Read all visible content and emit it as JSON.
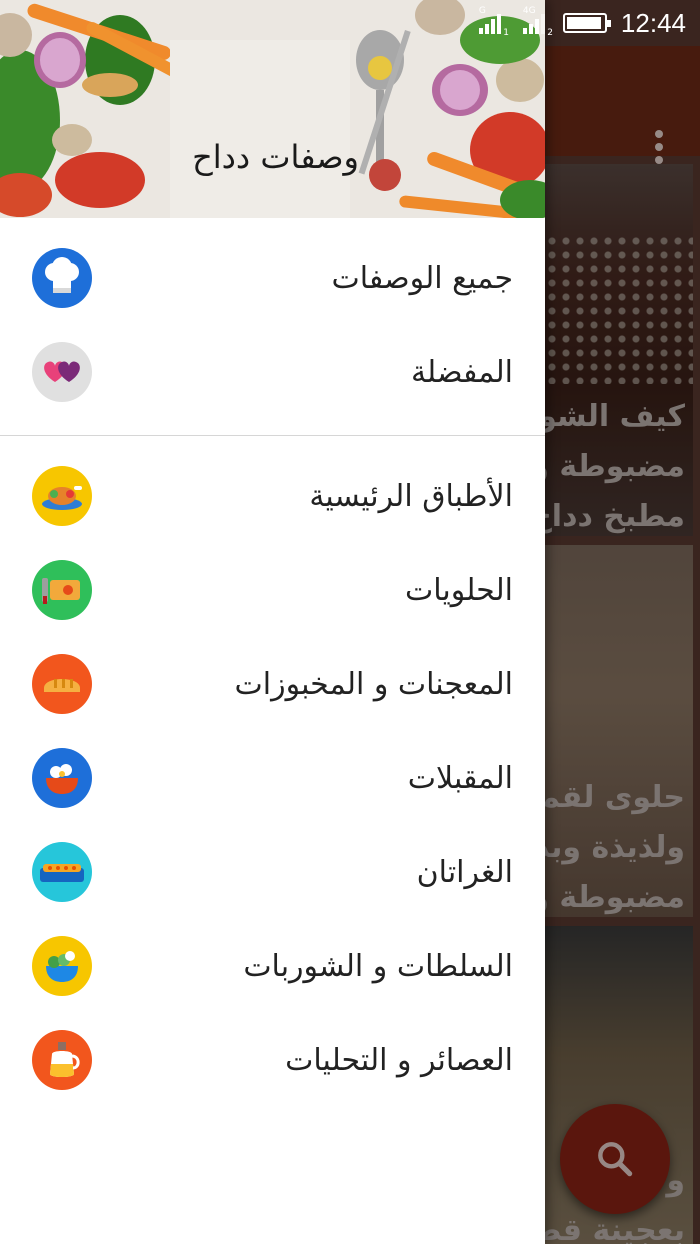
{
  "status_bar": {
    "sim1_label": "G",
    "sim1_sub": "1",
    "sim2_label": "4G",
    "sim2_sub": "2",
    "battery_level": 0.95,
    "time": "12:44"
  },
  "drawer": {
    "title": "وصفات دداح",
    "primary_items": [
      {
        "label": "جميع الوصفات",
        "icon": "chef-hat-icon",
        "color": "#1e6fd9"
      },
      {
        "label": "المفضلة",
        "icon": "hearts-icon",
        "color": "#e0e0e0"
      }
    ],
    "category_items": [
      {
        "label": "الأطباق الرئيسية",
        "icon": "roast-chicken-icon",
        "color": "#f7c600"
      },
      {
        "label": "الحلويات",
        "icon": "cake-board-icon",
        "color": "#2fbf5a"
      },
      {
        "label": "المعجنات و المخبوزات",
        "icon": "bread-icon",
        "color": "#f2561d"
      },
      {
        "label": "المقبلات",
        "icon": "appetizer-bowl-icon",
        "color": "#1e6fd9"
      },
      {
        "label": "الغراتان",
        "icon": "gratin-dish-icon",
        "color": "#26c6da"
      },
      {
        "label": "السلطات و الشوربات",
        "icon": "salad-bowl-icon",
        "color": "#f7c600"
      },
      {
        "label": "العصائر و التحليات",
        "icon": "juice-jug-icon",
        "color": "#f2561d"
      }
    ]
  },
  "background": {
    "cards": [
      {
        "lines": [
          "كيف الشوكولا",
          "مضبوطة و",
          "مطبخ دداح"
        ]
      },
      {
        "lines": [
          "حلوى لقميرة",
          "ولذيذة وبدون",
          "مضبوطة و"
        ]
      },
      {
        "lines": [
          "و",
          "بعجينة قطنية"
        ]
      }
    ]
  },
  "fab": {
    "icon": "search-icon",
    "color": "#8b2314"
  }
}
